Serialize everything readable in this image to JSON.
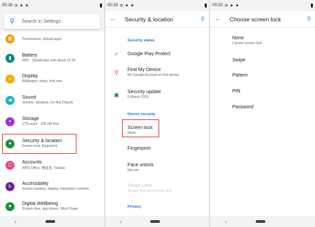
{
  "screen1": {
    "status_time": "00:18",
    "search_placeholder": "Search in Settings",
    "items": [
      {
        "title": "",
        "sub": "Permissions, default apps",
        "color": "#f29900",
        "icon": "apps-icon"
      },
      {
        "title": "Battery",
        "sub": "93% · Should last until about 12:30",
        "color": "#00897b",
        "icon": "battery-icon"
      },
      {
        "title": "Display",
        "sub": "Wallpaper, sleep, font size",
        "color": "#f9ab00",
        "icon": "brightness-icon"
      },
      {
        "title": "Sound",
        "sub": "Volume, vibration, Do Not Disturb",
        "color": "#12b5cb",
        "icon": "volume-icon"
      },
      {
        "title": "Storage",
        "sub": "17% used · 106 GB free",
        "color": "#9334e6",
        "icon": "storage-icon"
      },
      {
        "title": "Security & location",
        "sub": "Screen lock, fingerprint",
        "color": "#1e8e3e",
        "icon": "lock-icon"
      },
      {
        "title": "Accounts",
        "sub": "WPS Office, 微信多, Toutiao",
        "color": "#e8457f",
        "icon": "account-icon"
      },
      {
        "title": "Accessibility",
        "sub": "Screen readers, display, interaction controls",
        "color": "#6a1b9a",
        "icon": "accessibility-icon"
      },
      {
        "title": "Digital Wellbeing",
        "sub": "Screen time, app timers, Wind Down",
        "color": "#1e8e3e",
        "icon": "wellbeing-icon"
      }
    ]
  },
  "screen2": {
    "status_time": "00:19",
    "title": "Security & location",
    "section_status": "Security status",
    "section_device": "Device security",
    "section_privacy": "Privacy",
    "items": [
      {
        "title": "Google Play Protect",
        "sub": "",
        "icon": "shield-check-icon",
        "color": "#1e8e3e"
      },
      {
        "title": "Find My Device",
        "sub": "No Google Account on this device",
        "icon": "location-pin-icon",
        "color": "#d93025"
      },
      {
        "title": "Security update",
        "sub": "5 March 2019",
        "icon": "phone-update-icon",
        "color": "#1e8e3e"
      },
      {
        "title": "Screen lock",
        "sub": "None",
        "icon": "",
        "color": ""
      },
      {
        "title": "Fingerprint",
        "sub": "",
        "icon": "",
        "color": ""
      },
      {
        "title": "Face unlock",
        "sub": "Not set",
        "icon": "",
        "color": ""
      },
      {
        "title": "Smart Lock",
        "sub": "To use, first set a screen lock",
        "icon": "",
        "color": ""
      }
    ]
  },
  "screen3": {
    "status_time": "00:22",
    "title": "Choose screen lock",
    "options": [
      {
        "title": "None",
        "sub": "Current screen lock"
      },
      {
        "title": "Swipe",
        "sub": ""
      },
      {
        "title": "Pattern",
        "sub": ""
      },
      {
        "title": "PIN",
        "sub": ""
      },
      {
        "title": "Password",
        "sub": ""
      }
    ]
  },
  "colors": {
    "accent": "#1a73e8",
    "highlight": "#e53935"
  }
}
